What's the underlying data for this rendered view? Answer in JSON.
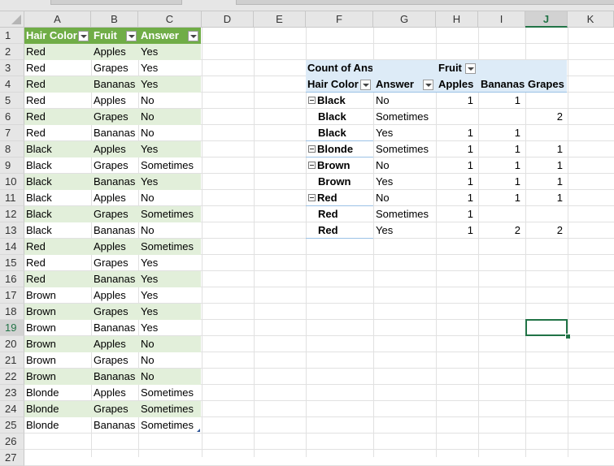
{
  "columns": [
    "A",
    "B",
    "C",
    "D",
    "E",
    "F",
    "G",
    "H",
    "I",
    "J",
    "K"
  ],
  "selected_column": "J",
  "selected_row": "19",
  "rows": [
    "1",
    "2",
    "3",
    "4",
    "5",
    "6",
    "7",
    "8",
    "9",
    "10",
    "11",
    "12",
    "13",
    "14",
    "15",
    "16",
    "17",
    "18",
    "19",
    "20",
    "21",
    "22",
    "23",
    "24",
    "25",
    "26",
    "27"
  ],
  "table": {
    "headers": [
      "Hair Color",
      "Fruit",
      "Answer"
    ],
    "rows": [
      [
        "Red",
        "Apples",
        "Yes"
      ],
      [
        "Red",
        "Grapes",
        "Yes"
      ],
      [
        "Red",
        "Bananas",
        "Yes"
      ],
      [
        "Red",
        "Apples",
        "No"
      ],
      [
        "Red",
        "Grapes",
        "No"
      ],
      [
        "Red",
        "Bananas",
        "No"
      ],
      [
        "Black",
        "Apples",
        "Yes"
      ],
      [
        "Black",
        "Grapes",
        "Sometimes"
      ],
      [
        "Black",
        "Bananas",
        "Yes"
      ],
      [
        "Black",
        "Apples",
        "No"
      ],
      [
        "Black",
        "Grapes",
        "Sometimes"
      ],
      [
        "Black",
        "Bananas",
        "No"
      ],
      [
        "Red",
        "Apples",
        "Sometimes"
      ],
      [
        "Red",
        "Grapes",
        "Yes"
      ],
      [
        "Red",
        "Bananas",
        "Yes"
      ],
      [
        "Brown",
        "Apples",
        "Yes"
      ],
      [
        "Brown",
        "Grapes",
        "Yes"
      ],
      [
        "Brown",
        "Bananas",
        "Yes"
      ],
      [
        "Brown",
        "Apples",
        "No"
      ],
      [
        "Brown",
        "Grapes",
        "No"
      ],
      [
        "Brown",
        "Bananas",
        "No"
      ],
      [
        "Blonde",
        "Apples",
        "Sometimes"
      ],
      [
        "Blonde",
        "Grapes",
        "Sometimes"
      ],
      [
        "Blonde",
        "Bananas",
        "Sometimes"
      ]
    ]
  },
  "pivot": {
    "values_label": "Count of Answer",
    "column_field": "Fruit",
    "row_field_1": "Hair Color",
    "row_field_2": "Answer",
    "column_items": [
      "Apples",
      "Bananas",
      "Grapes"
    ],
    "rows": [
      {
        "hair": "Black",
        "answer": "No",
        "values": [
          "1",
          "1",
          ""
        ],
        "collapse": true
      },
      {
        "hair": "Black",
        "answer": "Sometimes",
        "values": [
          "",
          "",
          "2"
        ],
        "collapse": false
      },
      {
        "hair": "Black",
        "answer": "Yes",
        "values": [
          "1",
          "1",
          ""
        ],
        "collapse": false
      },
      {
        "hair": "Blonde",
        "answer": "Sometimes",
        "values": [
          "1",
          "1",
          "1"
        ],
        "collapse": true
      },
      {
        "hair": "Brown",
        "answer": "No",
        "values": [
          "1",
          "1",
          "1"
        ],
        "collapse": true
      },
      {
        "hair": "Brown",
        "answer": "Yes",
        "values": [
          "1",
          "1",
          "1"
        ],
        "collapse": false
      },
      {
        "hair": "Red",
        "answer": "No",
        "values": [
          "1",
          "1",
          "1"
        ],
        "collapse": true
      },
      {
        "hair": "Red",
        "answer": "Sometimes",
        "values": [
          "1",
          "",
          ""
        ],
        "collapse": false
      },
      {
        "hair": "Red",
        "answer": "Yes",
        "values": [
          "1",
          "2",
          "2"
        ],
        "collapse": false
      }
    ]
  }
}
